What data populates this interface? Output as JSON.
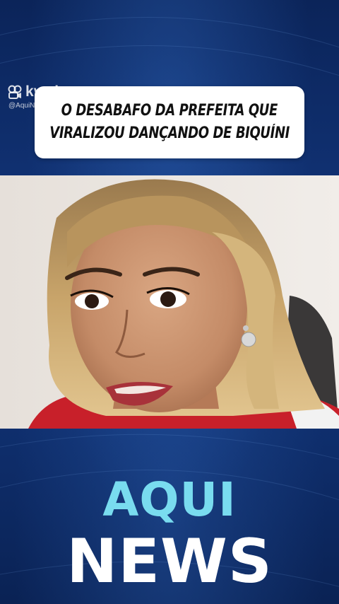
{
  "watermark": {
    "app_name": "kwai",
    "handle": "@AquiNews"
  },
  "headline": {
    "line1": "O DESABAFO DA PREFEITA QUE",
    "line2": "VIRALIZOU DANÇANDO DE BIQUÍNI"
  },
  "brand": {
    "word1": "AQUI",
    "word2": "NEWS"
  },
  "colors": {
    "background": "#0d2a63",
    "brand_aqui": "#79dcef",
    "brand_news": "#ffffff",
    "card": "#ffffff"
  }
}
